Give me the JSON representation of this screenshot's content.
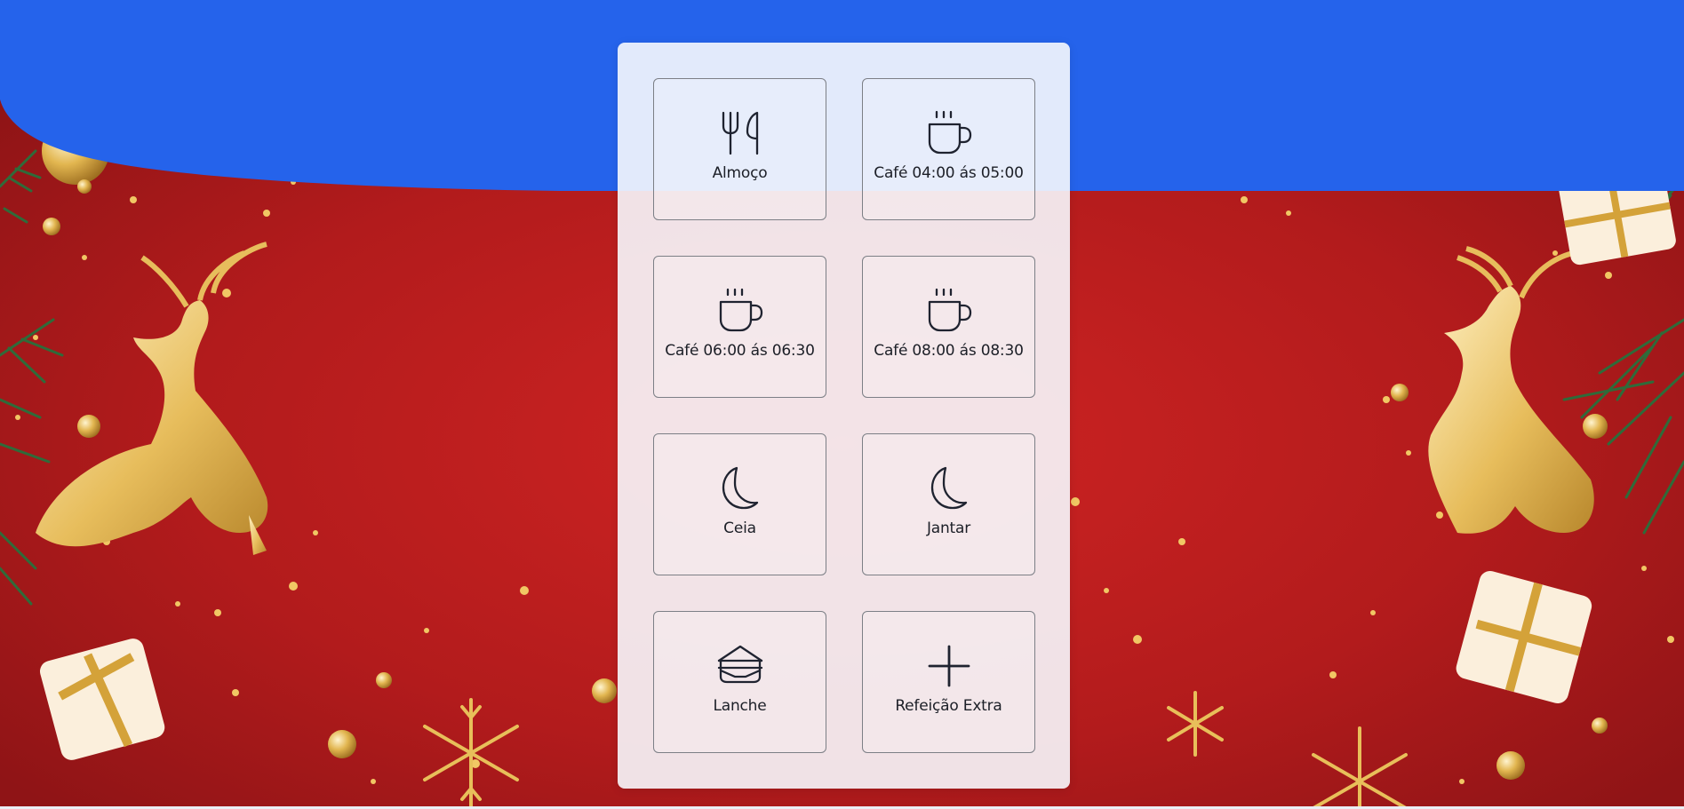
{
  "theme": {
    "header_blue": "#2563eb",
    "background_red": "#b01c1c",
    "gold": "#e8bf5a",
    "pine_green": "#2f6b3a",
    "panel_bg": "#f6f7fd",
    "icon_color": "#1f2330"
  },
  "meal_options": [
    {
      "id": "almoco",
      "label": "Almoço",
      "icon": "fork-knife-icon"
    },
    {
      "id": "cafe-0400",
      "label": "Café 04:00 ás 05:00",
      "icon": "coffee-cup-icon"
    },
    {
      "id": "cafe-0600",
      "label": "Café 06:00 ás 06:30",
      "icon": "coffee-cup-icon"
    },
    {
      "id": "cafe-0800",
      "label": "Café 08:00 ás 08:30",
      "icon": "coffee-cup-icon"
    },
    {
      "id": "ceia",
      "label": "Ceia",
      "icon": "moon-icon"
    },
    {
      "id": "jantar",
      "label": "Jantar",
      "icon": "moon-icon"
    },
    {
      "id": "lanche",
      "label": "Lanche",
      "icon": "sandwich-icon"
    },
    {
      "id": "refeicao-extra",
      "label": "Refeição Extra",
      "icon": "plus-icon"
    }
  ]
}
